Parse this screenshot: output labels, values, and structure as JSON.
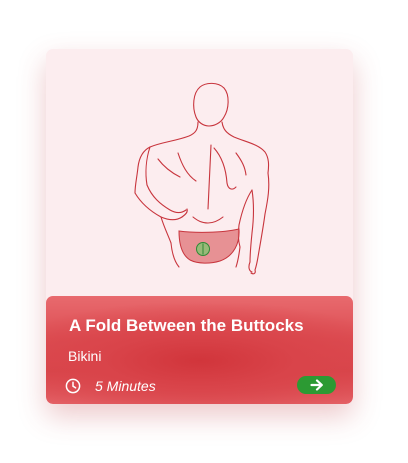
{
  "card": {
    "title": "A Fold Between the Buttocks",
    "category": "Bikini",
    "duration": "5 Minutes"
  },
  "icons": {
    "duration": "clock-icon",
    "action": "arrow-right-icon"
  },
  "colors": {
    "card_background": "#fcedef",
    "info_panel": "#d9444a",
    "button": "#2c9a33",
    "outline": "#c8353d",
    "marker": "#4caf50"
  }
}
